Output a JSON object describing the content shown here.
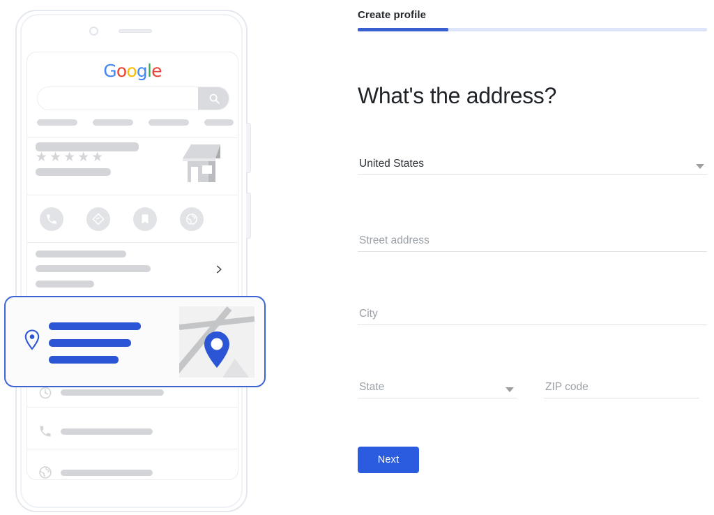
{
  "colors": {
    "brand_blue": "#2b5ce0",
    "progress_fill": "#3a5fd0",
    "progress_track": "#dde5fa",
    "highlight_border": "#3b63d4",
    "card_bar_blue": "#2b55d4",
    "placeholder_grey": "#9aa0a6",
    "value_dark": "#2c3136",
    "skeleton_grey": "#d3d5d8",
    "google_blue": "#4285F4",
    "google_red": "#EA4335",
    "google_yellow": "#FBBC05",
    "google_green": "#34A853"
  },
  "form": {
    "step_label": "Create profile",
    "progress_percent": 26,
    "heading": "What's the address?",
    "fields": [
      {
        "name": "country",
        "label": "United States",
        "type": "select",
        "filled": true,
        "caret": true
      },
      {
        "name": "street",
        "label": "Street address",
        "type": "text",
        "filled": false,
        "caret": false
      },
      {
        "name": "city",
        "label": "City",
        "type": "text",
        "filled": false,
        "caret": false
      },
      {
        "name": "state",
        "label": "State",
        "type": "select",
        "filled": false,
        "caret": true
      },
      {
        "name": "zip",
        "label": "ZIP code",
        "type": "text",
        "filled": false,
        "caret": false
      }
    ],
    "next_label": "Next"
  },
  "phone_mockup": {
    "google_logo_letters": [
      {
        "char": "G",
        "color_name": "google_blue"
      },
      {
        "char": "o",
        "color_name": "google_red"
      },
      {
        "char": "o",
        "color_name": "google_yellow"
      },
      {
        "char": "g",
        "color_name": "google_blue"
      },
      {
        "char": "l",
        "color_name": "google_green"
      },
      {
        "char": "e",
        "color_name": "google_red"
      }
    ],
    "search_icon": "search-icon",
    "chips_count": 4,
    "rating_stars": 5,
    "rating_star_glyph": "★",
    "storefront_icon": "storefront-icon",
    "action_icons": [
      "phone-icon",
      "directions-icon",
      "bookmark-icon",
      "globe-icon"
    ],
    "chevron_icon": "chevron-right-icon",
    "highlight_card": {
      "pin_icon": "location-pin-outline-icon",
      "bar_count": 3,
      "map_pin_icon": "map-pin-icon"
    },
    "bottom_rows": [
      {
        "icon": "clock-icon"
      },
      {
        "icon": "phone-icon"
      },
      {
        "icon": "globe-icon"
      }
    ]
  }
}
